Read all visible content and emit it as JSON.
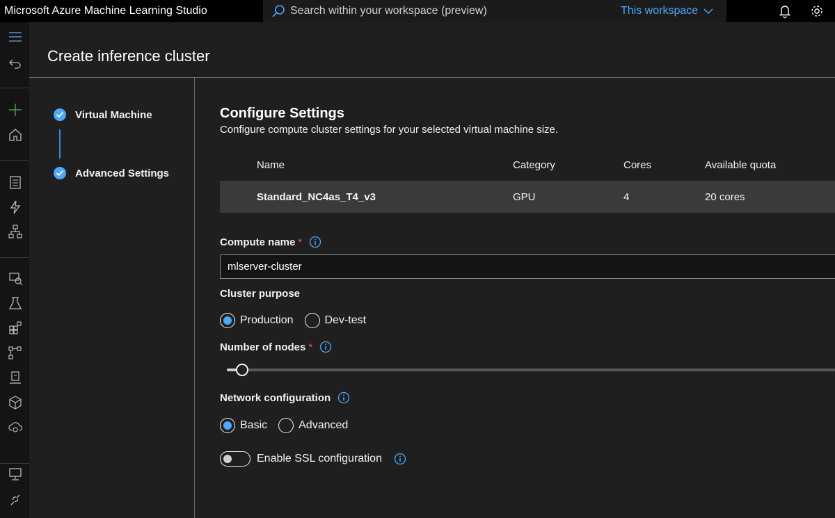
{
  "app": {
    "title": "Microsoft Azure Machine Learning Studio"
  },
  "search": {
    "placeholder": "Search within your workspace (preview)",
    "scope": "This workspace"
  },
  "page": {
    "title": "Create inference cluster"
  },
  "steps": [
    {
      "label": "Virtual Machine",
      "done": true
    },
    {
      "label": "Advanced Settings",
      "done": true
    }
  ],
  "settings": {
    "title": "Configure Settings",
    "description": "Configure compute cluster settings for your selected virtual machine size.",
    "table": {
      "headers": {
        "name": "Name",
        "category": "Category",
        "cores": "Cores",
        "quota": "Available quota"
      },
      "row": {
        "name": "Standard_NC4as_T4_v3",
        "category": "GPU",
        "cores": "4",
        "quota": "20 cores"
      }
    }
  },
  "compute_name": {
    "label": "Compute name",
    "required_mark": "*",
    "value": "mlserver-cluster"
  },
  "cluster_purpose": {
    "label": "Cluster purpose",
    "options": [
      "Production",
      "Dev-test"
    ],
    "selected": "Production"
  },
  "nodes": {
    "label": "Number of nodes",
    "required_mark": "*",
    "value_fraction": 0.025
  },
  "network": {
    "label": "Network configuration",
    "options": [
      "Basic",
      "Advanced"
    ],
    "selected": "Basic"
  },
  "ssl": {
    "label": "Enable SSL configuration",
    "enabled": false
  },
  "colors": {
    "accent": "#4aa8ff",
    "background": "#1f1f1f",
    "topbar": "#000000",
    "required": "#e0594a"
  }
}
